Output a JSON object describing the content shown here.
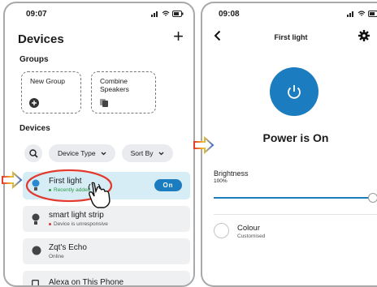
{
  "left_screen": {
    "status_time": "09:07",
    "title": "Devices",
    "add_symbol": "+",
    "groups_heading": "Groups",
    "groups": [
      {
        "label": "New Group",
        "icon": "plus-circle-icon"
      },
      {
        "label": "Combine Speakers",
        "icon": "speakers-icon"
      }
    ],
    "devices_heading": "Devices",
    "filters": {
      "device_type": "Device Type",
      "sort_by": "Sort By"
    },
    "devices": [
      {
        "name": "First light",
        "status": "Recently added",
        "status_color": "#2e9a45",
        "action": "On"
      },
      {
        "name": "smart light strip",
        "status": "Device is unresponsive",
        "status_color": "#d33a3a"
      },
      {
        "name": "Zqt's Echo",
        "status": "Online"
      },
      {
        "name": "Alexa on This Phone"
      }
    ]
  },
  "right_screen": {
    "status_time": "09:08",
    "title": "First light",
    "power_status": "Power is On",
    "brightness_label": "Brightness",
    "brightness_value": "100%",
    "brightness_level": 1.0,
    "colour_label": "Colour",
    "colour_value": "Customised"
  },
  "colors": {
    "accent": "#1b7cbf",
    "selected_row": "#d6edf5",
    "row": "#eef0f2"
  }
}
